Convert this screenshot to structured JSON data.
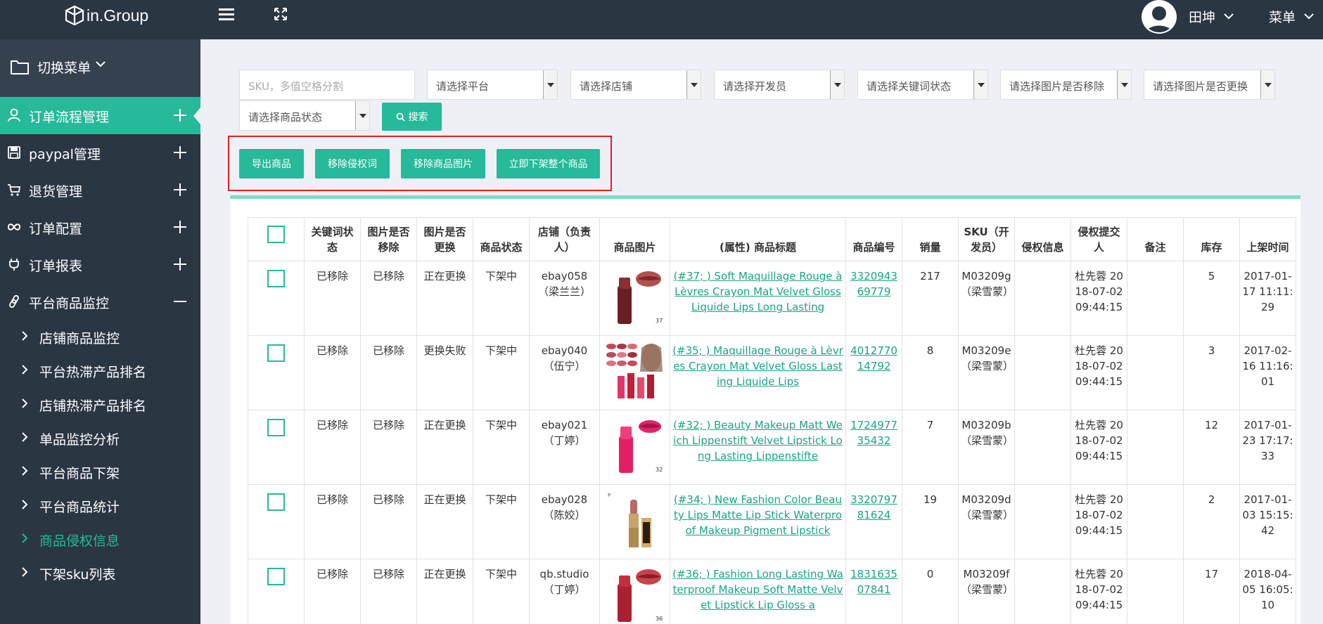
{
  "header": {
    "logo_text": "in.Group",
    "user_name": "田坤",
    "menu_label": "菜单"
  },
  "sidebar": {
    "switch_label": "切换菜单",
    "items": [
      {
        "label": "订单流程管理",
        "icon": "user-icon",
        "expanded": false,
        "active": true
      },
      {
        "label": "paypal管理",
        "icon": "save-icon",
        "expanded": false
      },
      {
        "label": "退货管理",
        "icon": "cart-icon",
        "expanded": false
      },
      {
        "label": "订单配置",
        "icon": "infinity-icon",
        "expanded": false
      },
      {
        "label": "订单报表",
        "icon": "plug-icon",
        "expanded": false
      },
      {
        "label": "平台商品监控",
        "icon": "link-icon",
        "expanded": true
      }
    ],
    "subitems": [
      {
        "label": "店铺商品监控"
      },
      {
        "label": "平台热滞产品排名"
      },
      {
        "label": "店铺热滞产品排名"
      },
      {
        "label": "单品监控分析"
      },
      {
        "label": "平台商品下架"
      },
      {
        "label": "平台商品统计"
      },
      {
        "label": "商品侵权信息",
        "current": true
      },
      {
        "label": "下架sku列表"
      }
    ]
  },
  "filters": {
    "sku_placeholder": "SKU，多值空格分割",
    "platform": "请选择平台",
    "shop": "请选择店铺",
    "developer": "请选择开发员",
    "keyword_status": "请选择关键词状态",
    "image_removed": "请选择图片是否移除",
    "image_replaced": "请选择图片是否更换",
    "product_status": "请选择商品状态",
    "search_label": "搜索"
  },
  "actions": {
    "export": "导出商品",
    "remove_words": "移除侵权词",
    "remove_images": "移除商品图片",
    "delist": "立即下架整个商品"
  },
  "colors": {
    "accent": "#26b99a",
    "sidebar_bg": "#2b3643",
    "highlight_border": "#e02020"
  },
  "table": {
    "headers": [
      "",
      "关键词状态",
      "图片是否移除",
      "图片是否更换",
      "商品状态",
      "店铺（负责人）",
      "商品图片",
      "(属性) 商品标题",
      "商品编号",
      "销量",
      "SKU（开发员）",
      "侵权信息",
      "侵权提交人",
      "备注",
      "库存",
      "上架时间"
    ],
    "rows": [
      {
        "keyword_status": "已移除",
        "image_removed": "已移除",
        "image_replaced": "正在更换",
        "status": "下架中",
        "shop": "ebay058（梁兰兰）",
        "image": "lipstick-dark-red",
        "title": "(#37; ) Soft Maquillage Rouge à Lèvres Crayon Mat Velvet Gloss Liquide Lips Long Lasting",
        "item_no": "332094369779",
        "sales": "217",
        "sku": "M03209g（梁雪蒙）",
        "infringe": "",
        "submitter": "杜先蓉 2018-07-02 09:44:15",
        "remark": "",
        "stock": "5",
        "listed": "2017-01-17 11:11:29"
      },
      {
        "keyword_status": "已移除",
        "image_removed": "已移除",
        "image_replaced": "更换失败",
        "status": "下架中",
        "shop": "ebay040（伍宁）",
        "image": "lipstick-palette",
        "title": "(#35; ) Maquillage Rouge à Lèvres Crayon Mat Velvet Gloss Lasting Liquide Lips",
        "item_no": "401277014792",
        "sales": "8",
        "sku": "M03209e（梁雪蒙）",
        "infringe": "",
        "submitter": "杜先蓉 2018-07-02 09:44:15",
        "remark": "",
        "stock": "3",
        "listed": "2017-02-16 11:16:01"
      },
      {
        "keyword_status": "已移除",
        "image_removed": "已移除",
        "image_replaced": "正在更换",
        "status": "下架中",
        "shop": "ebay021（丁婷）",
        "image": "lipstick-pink",
        "title": "(#32; ) Beauty Makeup Matt Weich Lippenstift Velvet Lipstick Long Lasting Lippenstifte",
        "item_no": "172497735432",
        "sales": "7",
        "sku": "M03209b（梁雪蒙）",
        "infringe": "",
        "submitter": "杜先蓉 2018-07-02 09:44:15",
        "remark": "",
        "stock": "12",
        "listed": "2017-01-23 17:17:33"
      },
      {
        "keyword_status": "已移除",
        "image_removed": "已移除",
        "image_replaced": "正在更换",
        "status": "下架中",
        "shop": "ebay028（陈姣）",
        "image": "lipstick-gold",
        "title": "(#34; ) New Fashion Color Beauty Lips Matte Lip Stick Waterproof Makeup Pigment Lipstick",
        "item_no": "332079781624",
        "sales": "19",
        "sku": "M03209d（梁雪蒙）",
        "infringe": "",
        "submitter": "杜先蓉 2018-07-02 09:44:15",
        "remark": "",
        "stock": "2",
        "listed": "2017-01-03 15:15:42"
      },
      {
        "keyword_status": "已移除",
        "image_removed": "已移除",
        "image_replaced": "正在更换",
        "status": "下架中",
        "shop": "qb.studio（丁婷）",
        "image": "lipstick-red",
        "title": "(#36; ) Fashion Long Lasting Waterproof Makeup Soft Matte Velvet Lipstick Lip Gloss a",
        "item_no": "183163507841",
        "sales": "0",
        "sku": "M03209f（梁雪蒙）",
        "infringe": "",
        "submitter": "杜先蓉 2018-07-02 09:44:15",
        "remark": "",
        "stock": "17",
        "listed": "2018-04-05 16:05:10"
      }
    ]
  }
}
